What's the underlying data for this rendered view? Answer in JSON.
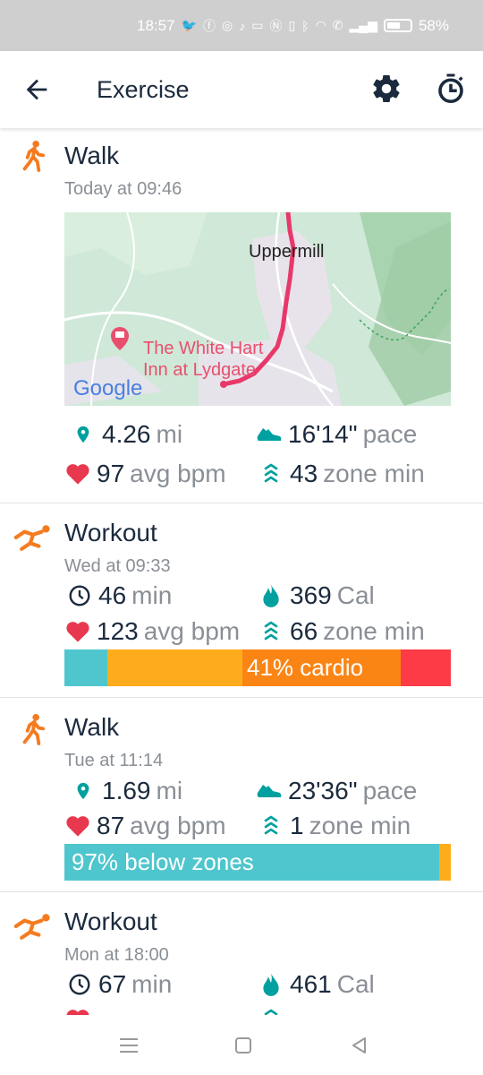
{
  "status_bar": {
    "time": "18:57",
    "battery_percent": "58%",
    "notification_icons": [
      "twitter-icon",
      "facebook-icon",
      "instagram-icon",
      "tiktok-icon",
      "news-icon"
    ],
    "system_icons": [
      "nfc-icon",
      "vibrate-icon",
      "bluetooth-icon",
      "wifi-icon",
      "call-icon",
      "signal-icon",
      "battery-icon"
    ]
  },
  "app_bar": {
    "title": "Exercise",
    "back_icon": "arrow-left-icon",
    "settings_icon": "gear-icon",
    "timer_icon": "stopwatch-icon"
  },
  "colors": {
    "walk": "#f47b20",
    "heart": "#e8384f",
    "teal": "#00a0a0",
    "below_zones": "#4fc6cd",
    "fat_burn": "#ffac1c",
    "cardio": "#fa8514",
    "peak": "#fc3b47"
  },
  "activities": [
    {
      "name": "Walk",
      "date": "Today at 09:46",
      "icon": "walk-icon",
      "map": {
        "place_label": "Uppermill",
        "poi_label_line1": "The White Hart",
        "poi_label_line2": "Inn at Lydgate",
        "attribution": "Google"
      },
      "stats": [
        {
          "icon": "location-pin-icon",
          "value": "4.26",
          "unit": "mi"
        },
        {
          "icon": "shoe-icon",
          "value": "16'14\"",
          "unit": "pace"
        },
        {
          "icon": "heart-icon",
          "value": "97",
          "unit": "avg bpm"
        },
        {
          "icon": "zone-chevrons-icon",
          "value": "43",
          "unit": "zone min"
        }
      ]
    },
    {
      "name": "Workout",
      "date": "Wed at 09:33",
      "icon": "workout-icon",
      "stats": [
        {
          "icon": "clock-icon",
          "value": "46",
          "unit": "min"
        },
        {
          "icon": "flame-icon",
          "value": "369",
          "unit": "Cal"
        },
        {
          "icon": "heart-icon",
          "value": "123",
          "unit": "avg bpm"
        },
        {
          "icon": "zone-chevrons-icon",
          "value": "66",
          "unit": "zone min"
        }
      ],
      "zones": {
        "label": "41% cardio",
        "segments": [
          {
            "zone": "below",
            "fraction": 0.11
          },
          {
            "zone": "fat_burn",
            "fraction": 0.35
          },
          {
            "zone": "cardio",
            "fraction": 0.41
          },
          {
            "zone": "peak",
            "fraction": 0.13
          }
        ]
      }
    },
    {
      "name": "Walk",
      "date": "Tue at 11:14",
      "icon": "walk-icon",
      "stats": [
        {
          "icon": "location-pin-icon",
          "value": "1.69",
          "unit": "mi"
        },
        {
          "icon": "shoe-icon",
          "value": "23'36\"",
          "unit": "pace"
        },
        {
          "icon": "heart-icon",
          "value": "87",
          "unit": "avg bpm"
        },
        {
          "icon": "zone-chevrons-icon",
          "value": "1",
          "unit": "zone min"
        }
      ],
      "zones": {
        "label": "97% below zones",
        "segments": [
          {
            "zone": "below",
            "fraction": 0.97
          },
          {
            "zone": "fat_burn",
            "fraction": 0.03
          }
        ]
      }
    },
    {
      "name": "Workout",
      "date": "Mon at 18:00",
      "icon": "workout-icon",
      "stats": [
        {
          "icon": "clock-icon",
          "value": "67",
          "unit": "min"
        },
        {
          "icon": "flame-icon",
          "value": "461",
          "unit": "Cal"
        }
      ]
    }
  ],
  "nav_bar": {
    "menu_icon": "recents-icon",
    "home_icon": "home-icon",
    "back_icon": "back-triangle-icon"
  }
}
